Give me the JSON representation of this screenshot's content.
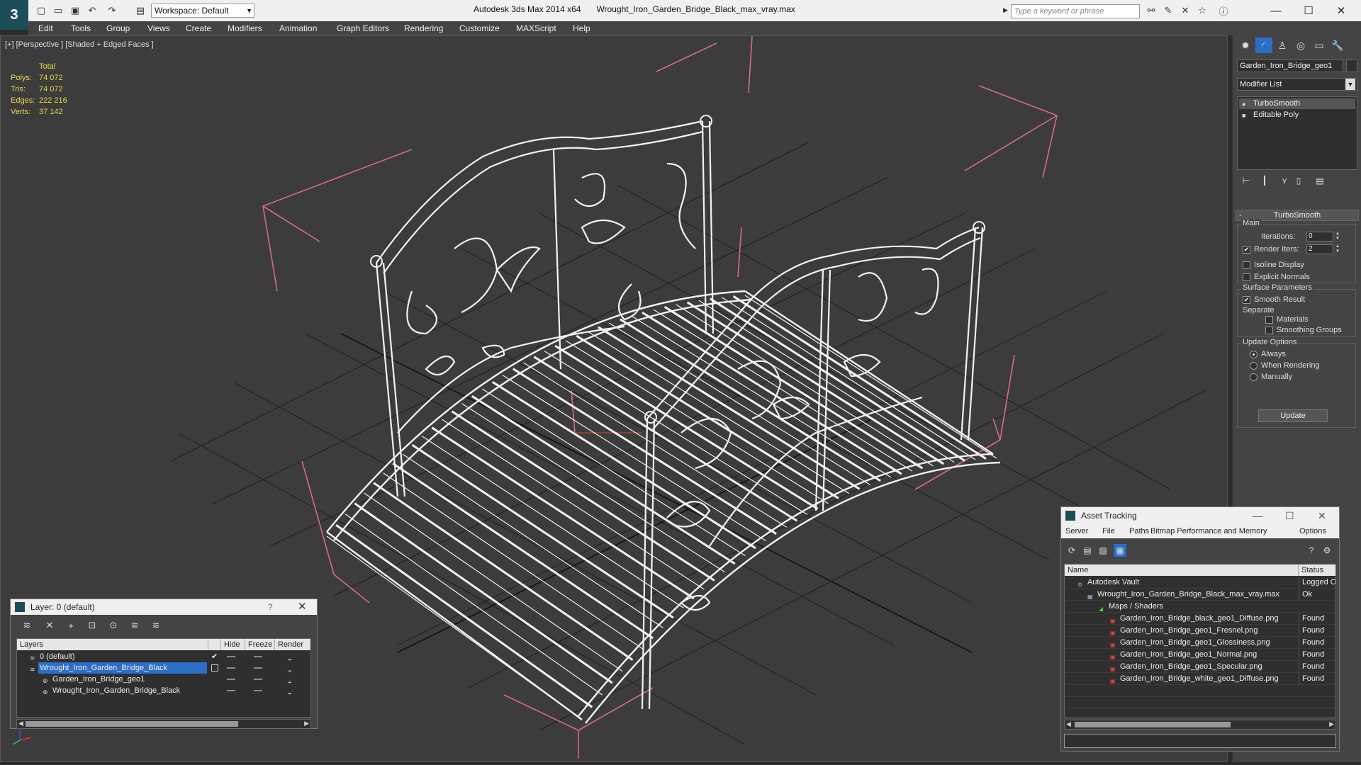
{
  "app": {
    "logo_text": "3",
    "title": "Autodesk 3ds Max  2014 x64",
    "file": "Wrought_Iron_Garden_Bridge_Black_max_vray.max",
    "workspace": "Workspace: Default",
    "search_placeholder": "Type a keyword or phrase"
  },
  "menu": [
    "Edit",
    "Tools",
    "Group",
    "Views",
    "Create",
    "Modifiers",
    "Animation",
    "Graph Editors",
    "Rendering",
    "Customize",
    "MAXScript",
    "Help"
  ],
  "viewport": {
    "label": "[+] [Perspective ] [Shaded + Edged Faces ]",
    "stats": {
      "total_label": "Total",
      "rows": [
        {
          "k": "Polys:",
          "v": "74 072"
        },
        {
          "k": "Tris:",
          "v": "74 072"
        },
        {
          "k": "Edges:",
          "v": "222 216"
        },
        {
          "k": "Verts:",
          "v": "37 142"
        }
      ]
    }
  },
  "command_panel": {
    "object_name": "Garden_Iron_Bridge_geo1",
    "modifier_list": "Modifier List",
    "stack": [
      "TurboSmooth",
      "Editable Poly"
    ],
    "rollout_title": "TurboSmooth",
    "main_label": "Main",
    "iterations_label": "Iterations:",
    "iterations_value": "0",
    "render_iters_label": "Render Iters:",
    "render_iters_value": "2",
    "isoline_label": "Isoline Display",
    "explicit_normals_label": "Explicit Normals",
    "surface_params_label": "Surface Parameters",
    "smooth_result_label": "Smooth Result",
    "separate_label": "Separate",
    "materials_label": "Materials",
    "smoothing_groups_label": "Smoothing Groups",
    "update_options_label": "Update Options",
    "always_label": "Always",
    "when_rendering_label": "When Rendering",
    "manually_label": "Manually",
    "update_button": "Update"
  },
  "layer_dialog": {
    "title": "Layer: 0 (default)",
    "help": "?",
    "columns": [
      "Layers",
      "Hide",
      "Freeze",
      "Render"
    ],
    "rows": [
      {
        "name": "0 (default)",
        "indent": 1,
        "selected": false,
        "check": "✔"
      },
      {
        "name": "Wrought_Iron_Garden_Bridge_Black",
        "indent": 1,
        "selected": true,
        "check": ""
      },
      {
        "name": "Garden_Iron_Bridge_geo1",
        "indent": 2,
        "selected": false,
        "check": ""
      },
      {
        "name": "Wrought_Iron_Garden_Bridge_Black",
        "indent": 2,
        "selected": false,
        "check": ""
      }
    ]
  },
  "asset_dialog": {
    "title": "Asset Tracking",
    "menu": [
      "Server",
      "File",
      "Paths",
      "Bitmap Performance and Memory",
      "Options"
    ],
    "columns": [
      "Name",
      "Status"
    ],
    "rows": [
      {
        "name": "Autodesk Vault",
        "indent": 1,
        "status": "Logged O"
      },
      {
        "name": "Wrought_Iron_Garden_Bridge_Black_max_vray.max",
        "indent": 2,
        "status": "Ok"
      },
      {
        "name": "Maps / Shaders",
        "indent": 3,
        "status": ""
      },
      {
        "name": "Garden_Iron_Bridge_black_geo1_Diffuse.png",
        "indent": 4,
        "status": "Found"
      },
      {
        "name": "Garden_Iron_Bridge_geo1_Fresnel.png",
        "indent": 4,
        "status": "Found"
      },
      {
        "name": "Garden_Iron_Bridge_geo1_Glossiness.png",
        "indent": 4,
        "status": "Found"
      },
      {
        "name": "Garden_Iron_Bridge_geo1_Normal.png",
        "indent": 4,
        "status": "Found"
      },
      {
        "name": "Garden_Iron_Bridge_geo1_Specular.png",
        "indent": 4,
        "status": "Found"
      },
      {
        "name": "Garden_Iron_Bridge_white_geo1_Diffuse.png",
        "indent": 4,
        "status": "Found"
      }
    ]
  },
  "colors": {
    "viewport_bg": "#3c3c3c",
    "stats_text": "#e8d84a",
    "wire": "#f2f2f2",
    "bbox": "#d86a8a",
    "grid": "#222222",
    "selection": "#2d6ec7"
  }
}
